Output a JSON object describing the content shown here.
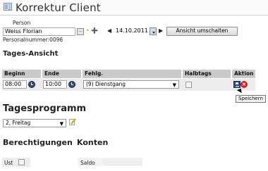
{
  "window": {
    "title": "Korrektur Client"
  },
  "person": {
    "label": "Person",
    "name_value": "Weiss Florian",
    "personal_number": "Personalnummer:0096",
    "more_button": "..."
  },
  "date": {
    "value": "14.10.2011",
    "prev_arrow": "◆",
    "next_arrow": "◆",
    "toggle_view_button": "Ansicht umschalten"
  },
  "tages_ansicht": {
    "heading": "Tages-Ansicht",
    "columns": [
      "Beginn",
      "Ende",
      "Fehlg.",
      "Halbtags",
      "Aktion"
    ],
    "row": {
      "beginn": "08:00",
      "ende": "10:00",
      "fehlgrund": "(9) Dienstgang",
      "halbtags": false
    },
    "tooltip": "Speichern"
  },
  "tagesprogramm": {
    "heading": "Tagesprogramm",
    "selected": "2, Freitag"
  },
  "berechtigungen": {
    "heading": "Berechtigungen"
  },
  "konten": {
    "heading": "Konten",
    "ust_label": "Ust",
    "saldo_label": "Saldo",
    "saldo_value": ""
  },
  "icons": {
    "app": "app-window-icon",
    "clock": "clock-icon",
    "save": "floppy-save-icon",
    "delete": "delete-icon",
    "edit": "pencil-edit-icon",
    "calendar": "calendar-dropdown-icon"
  },
  "colors": {
    "table_header": "#c9c9c9",
    "table_row": "#ececec",
    "delete_red": "#d61f1f",
    "clock_blue": "#35506e"
  }
}
